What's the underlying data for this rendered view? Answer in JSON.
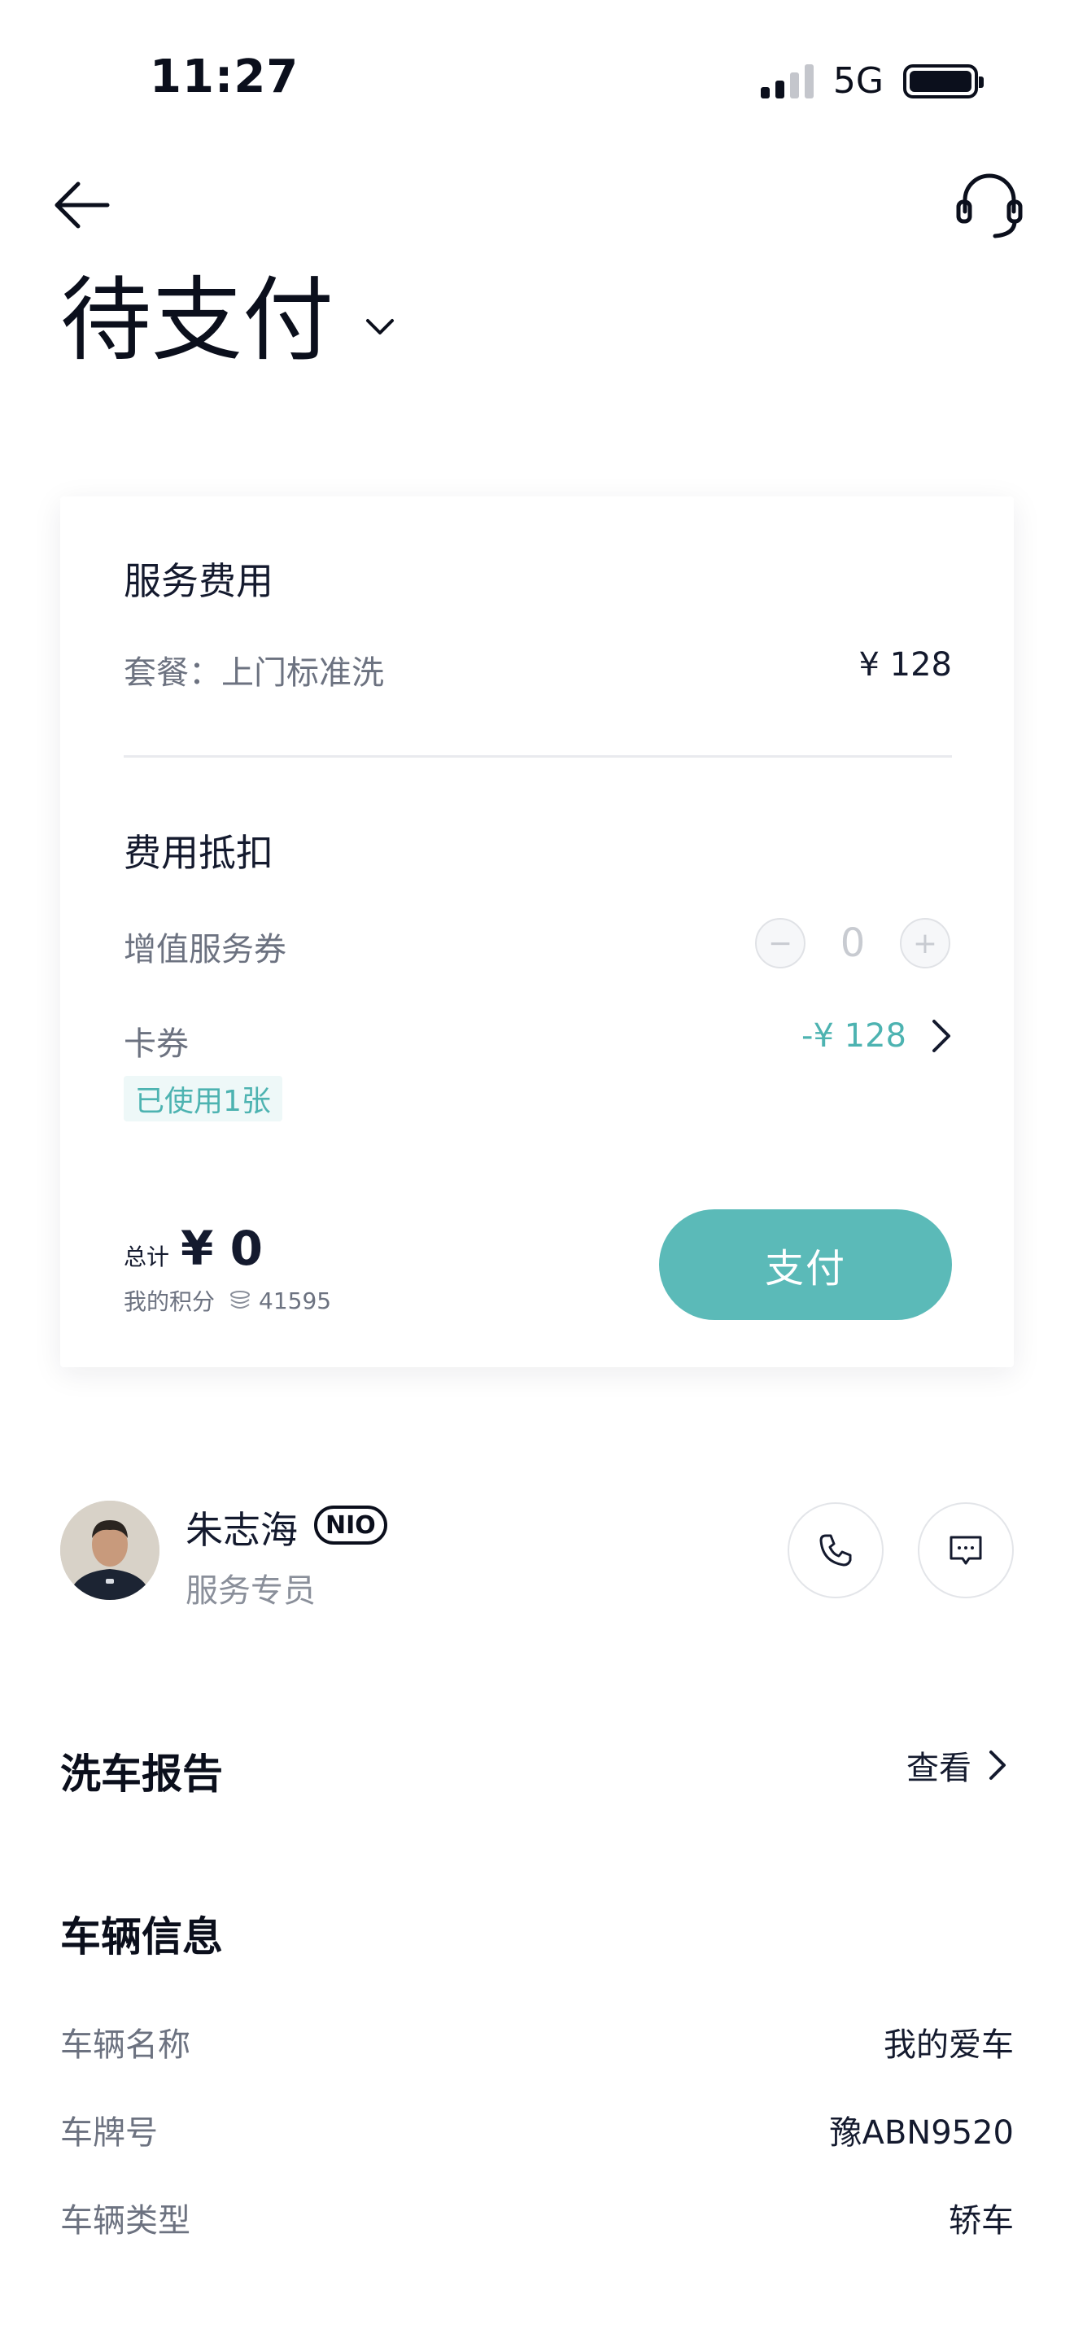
{
  "status_bar": {
    "time": "11:27",
    "network": "5G"
  },
  "header": {
    "title": "待支付"
  },
  "fee_card": {
    "service_fee_title": "服务费用",
    "package_label": "套餐：上门标准洗",
    "package_price": "¥ 128",
    "deduction_title": "费用抵扣",
    "value_added_label": "增值服务券",
    "value_added_minus": "−",
    "value_added_count": "0",
    "value_added_plus": "+",
    "voucher_label": "卡券",
    "voucher_amount": "-¥ 128",
    "voucher_used": "已使用1张",
    "total_label": "总计",
    "total_amount": "¥ 0",
    "points_label": "我的积分",
    "points_value": "41595",
    "pay_label": "支付"
  },
  "staff": {
    "name": "朱志海",
    "badge": "NIO",
    "role": "服务专员"
  },
  "wash_report": {
    "title": "洗车报告",
    "link": "查看"
  },
  "vehicle": {
    "title": "车辆信息",
    "rows": [
      {
        "label": "车辆名称",
        "value": "我的爱车"
      },
      {
        "label": "车牌号",
        "value": "豫ABN9520"
      },
      {
        "label": "车辆类型",
        "value": "轿车"
      }
    ]
  },
  "colors": {
    "accent": "#5bbab8",
    "accent_text": "#4db3b1",
    "text": "#141a2e",
    "muted": "#6c7280"
  }
}
